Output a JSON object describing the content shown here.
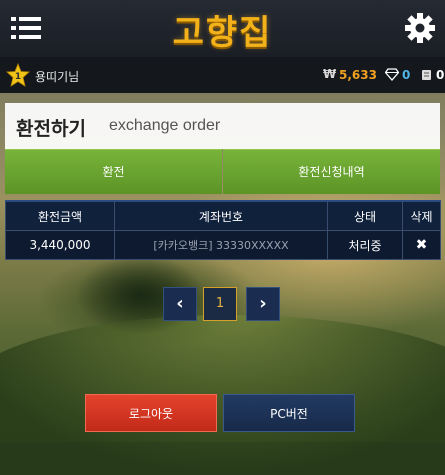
{
  "header": {
    "logo_text": "고향집",
    "menu_icon": "hamburger-menu-icon",
    "settings_icon": "gear-icon"
  },
  "user": {
    "level": "1",
    "name": "용띠기님",
    "currency_symbol": "₩",
    "money": "5,633",
    "diamonds": "0",
    "tickets": "0"
  },
  "panel": {
    "title": "환전하기",
    "subtitle": "exchange order",
    "tabs": [
      {
        "label": "환전"
      },
      {
        "label": "환전신청내역"
      }
    ]
  },
  "table": {
    "headers": [
      "환전금액",
      "계좌번호",
      "상태",
      "삭제"
    ],
    "rows": [
      {
        "amount": "3,440,000",
        "account": "[카카오뱅크] 33330XXXXX",
        "status": "처리중",
        "delete": "✖"
      }
    ]
  },
  "pagination": {
    "prev": "‹",
    "current": "1",
    "next": "›"
  },
  "footer": {
    "logout_label": "로그아웃",
    "pc_label": "PC버전"
  },
  "colors": {
    "accent_gold": "#f0a020",
    "tab_green": "#6aa532",
    "logout_red": "#d9341f",
    "navy": "#10213c"
  }
}
